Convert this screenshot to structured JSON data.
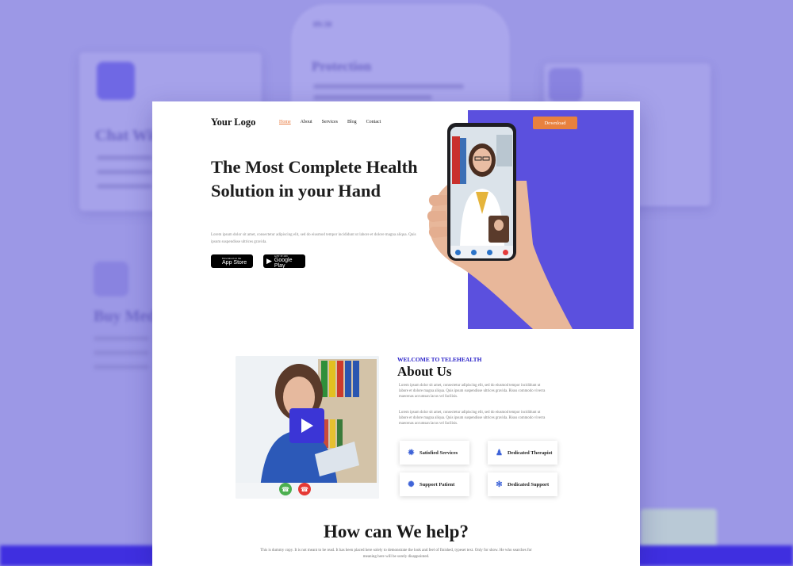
{
  "background": {
    "card1_title": "Chat Wit",
    "card2_title": "Buy Medi",
    "phone_heading": "Protection",
    "phone_time": "09:30"
  },
  "header": {
    "logo": "Your Logo",
    "nav": [
      "Home",
      "About",
      "Services",
      "Blog",
      "Contact"
    ],
    "download": "Download"
  },
  "hero": {
    "title": "The Most Complete Health Solution in your Hand",
    "description": "Lorem ipsum dolor sit amet, consectetur adipiscing elit, sed do eiusmod tempor incididunt ut labore et dolore magna aliqua. Quis ipsum suspendisse ultrices gravida.",
    "app_store_small": "Download on the",
    "app_store": "App Store",
    "google_play_small": "GET IT ON",
    "google_play": "Google Play"
  },
  "about": {
    "eyebrow": "WELCOME TO TELEHEALTH",
    "title": "About Us",
    "paragraph1": "Lorem ipsum dolor sit amet, consectetur adipiscing elit, sed do eiusmod tempor incididunt ut labore et dolore magna aliqua. Quis ipsum suspendisse ultrices gravida. Risus commodo viverra maecenas accumsan lacus vel facilisis.",
    "paragraph2": "Lorem ipsum dolor sit amet, consectetur adipiscing elit, sed do eiusmod tempor incididunt ut labore et dolore magna aliqua. Quis ipsum suspendisse ultrices gravida. Risus commodo viverra maecenas accumsan lacus vel facilisis.",
    "features": [
      "Satisfied Services",
      "Dedicated Therapist",
      "Support Patient",
      "Dedicated Support"
    ]
  },
  "help": {
    "title": "How can We help?",
    "description": "This is dummy copy. It is not meant to be read. It has been placed here solely to demonstrate the look and feel of finished, typeset text. Only for show. He who searches for meaning here will be sorely disappointed."
  },
  "colors": {
    "accent": "#5b50de",
    "orange": "#e8813e",
    "background": "#9c98e6"
  }
}
